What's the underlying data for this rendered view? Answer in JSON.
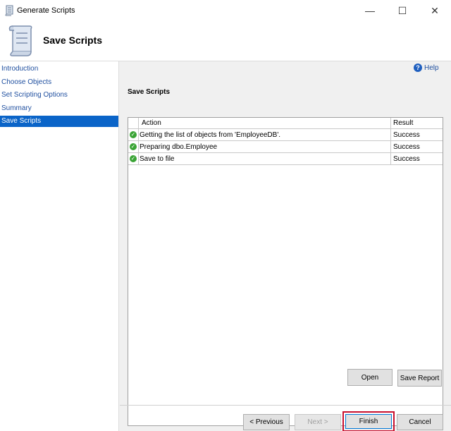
{
  "window": {
    "title": "Generate Scripts",
    "minimize_icon": "minimize-icon",
    "maximize_icon": "maximize-icon",
    "close_icon": "close-icon"
  },
  "banner": {
    "title": "Save Scripts",
    "icon": "script-scroll-icon"
  },
  "sidebar": {
    "items": [
      {
        "label": "Introduction"
      },
      {
        "label": "Choose Objects"
      },
      {
        "label": "Set Scripting Options"
      },
      {
        "label": "Summary"
      },
      {
        "label": "Save Scripts"
      }
    ],
    "active_index": 4
  },
  "help": {
    "label": "Help"
  },
  "section": {
    "title": "Save Scripts"
  },
  "results": {
    "columns": [
      "Action",
      "Result"
    ],
    "rows": [
      {
        "action": "Getting the list of objects from 'EmployeeDB'.",
        "result": "Success"
      },
      {
        "action": "Preparing dbo.Employee",
        "result": "Success"
      },
      {
        "action": "Save to file",
        "result": "Success"
      }
    ]
  },
  "buttons": {
    "open": "Open",
    "save_report": "Save Report",
    "previous": "< Previous",
    "next": "Next >",
    "finish": "Finish",
    "cancel": "Cancel"
  },
  "colors": {
    "accent": "#0a64c8",
    "success": "#3aa435",
    "highlight": "#c8102e"
  }
}
